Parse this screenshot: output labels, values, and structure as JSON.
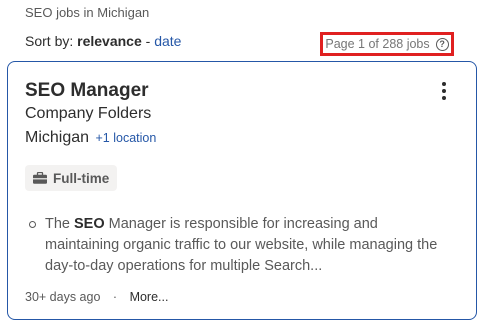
{
  "breadcrumb": "SEO jobs in Michigan",
  "sort": {
    "label": "Sort by:",
    "active": "relevance",
    "separator": "-",
    "alternative": "date"
  },
  "page_count": "Page 1 of 288 jobs",
  "help_icon": "question-circle-icon",
  "job": {
    "title": "SEO Manager",
    "company": "Company Folders",
    "location": "Michigan",
    "more_locations": "+1 location",
    "job_type": "Full-time",
    "snippet_parts": {
      "before": "The ",
      "highlight": "SEO",
      "after": " Manager is responsible for increasing and maintaining organic traffic to our website, while managing the day-to-day operations for multiple Search..."
    },
    "posted": "30+ days ago",
    "meta_separator": "·",
    "more_link": "More..."
  },
  "colors": {
    "accent_link": "#2557a7",
    "highlight_border": "#e02020",
    "card_border": "#2557a7",
    "badge_bg": "#f3f2f1"
  }
}
